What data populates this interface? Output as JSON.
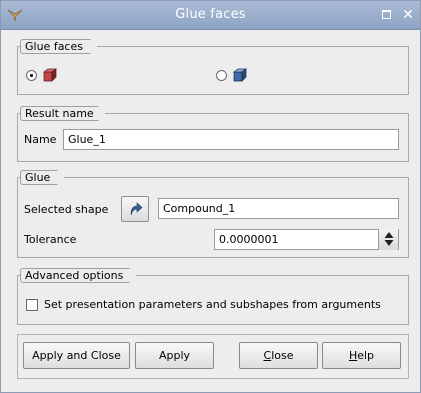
{
  "window": {
    "title": "Glue faces",
    "icons": {
      "app": "app-logo-icon",
      "maximize": "maximize-icon",
      "close": "close-icon"
    },
    "close_glyph": "✕"
  },
  "glue_faces_group": {
    "title": "Glue faces",
    "options": [
      {
        "icon": "solid-box-icon",
        "selected": true
      },
      {
        "icon": "faces-box-icon",
        "selected": false
      }
    ]
  },
  "result_group": {
    "title": "Result name",
    "name_label": "Name",
    "name_value": "Glue_1"
  },
  "glue_group": {
    "title": "Glue",
    "selected_shape_label": "Selected shape",
    "selected_shape_value": "Compound_1",
    "select_icon": "arrow-select-icon",
    "tolerance_label": "Tolerance",
    "tolerance_value": "0.0000001"
  },
  "advanced_group": {
    "title": "Advanced options",
    "checkbox_label": "Set presentation parameters and subshapes from arguments",
    "checked": false
  },
  "buttons": {
    "apply_close": "Apply and Close",
    "apply": "Apply",
    "close_prefix": "",
    "close_underlined": "C",
    "close_rest": "lose",
    "help_prefix": "",
    "help_underlined": "H",
    "help_rest": "elp"
  },
  "colors": {
    "titlebar": "#9bb0cf",
    "window_bg": "#ededed"
  }
}
